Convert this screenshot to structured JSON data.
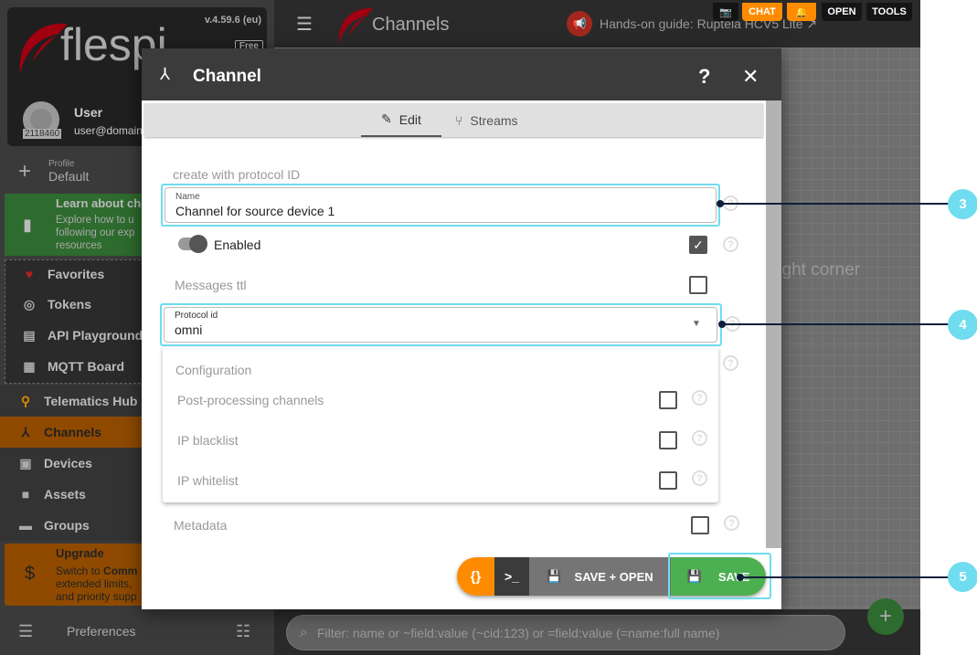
{
  "app": {
    "version": "v.4.59.6 (eu)",
    "plan": "Free",
    "logo": "flespi"
  },
  "user": {
    "name": "User",
    "email": "user@domain",
    "id": "2118460"
  },
  "profile": {
    "label": "Profile",
    "value": "Default"
  },
  "learn": {
    "title": "Learn about ch",
    "text": "Explore how to u following our exp resources"
  },
  "favorites": [
    {
      "label": "Favorites",
      "icon": "heart-icon"
    },
    {
      "label": "Tokens",
      "icon": "fingerprint-icon"
    },
    {
      "label": "API Playground",
      "icon": "book-icon"
    },
    {
      "label": "MQTT Board",
      "icon": "dashboard-icon"
    }
  ],
  "nav": [
    {
      "label": "Telematics Hub",
      "icon": "hub-icon"
    },
    {
      "label": "Channels",
      "icon": "channel-icon",
      "active": true
    },
    {
      "label": "Devices",
      "icon": "device-icon"
    },
    {
      "label": "Assets",
      "icon": "asset-icon"
    },
    {
      "label": "Groups",
      "icon": "folder-icon"
    }
  ],
  "upgrade": {
    "title": "Upgrade",
    "line1": "Switch to ",
    "bold": "Comm",
    "line2": "extended limits,",
    "line3": "and priority supp"
  },
  "preferences": "Preferences",
  "topbar": {
    "title": "Channels",
    "guide": "Hands-on guide: Ruptela HCV5 Lite",
    "chat": "CHAT",
    "open": "OPEN",
    "tools": "TOOLS"
  },
  "canvas_hint": "right corner",
  "filter_placeholder": "Filter: name or ~field:value (~cid:123) or =field:value (=name:full name)",
  "dialog": {
    "title": "Channel",
    "help": "?",
    "close": "✕",
    "tabs": [
      {
        "label": "Edit",
        "active": true
      },
      {
        "label": "Streams"
      }
    ],
    "create_with": "create with protocol ID",
    "name": {
      "label": "Name",
      "value": "Channel for source device 1"
    },
    "enabled": {
      "label": "Enabled",
      "on": true,
      "checked": true
    },
    "messages_ttl": {
      "label": "Messages ttl",
      "checked": false
    },
    "protocol": {
      "label": "Protocol id",
      "value": "omni"
    },
    "configuration": {
      "title": "Configuration",
      "items": [
        {
          "label": "Post-processing channels",
          "checked": false
        },
        {
          "label": "IP blacklist",
          "checked": false
        },
        {
          "label": "IP whitelist",
          "checked": false
        }
      ]
    },
    "metadata": {
      "label": "Metadata",
      "checked": false
    },
    "actions": {
      "json": "{}",
      "terminal": ">_",
      "save_open": "SAVE + OPEN",
      "save": "SAVE"
    }
  },
  "callouts": [
    "3",
    "4",
    "5"
  ],
  "colors": {
    "accent": "#ff8c00",
    "save": "#4caf50",
    "callout": "#6fdcef",
    "active_nav": "#8f4a00"
  }
}
